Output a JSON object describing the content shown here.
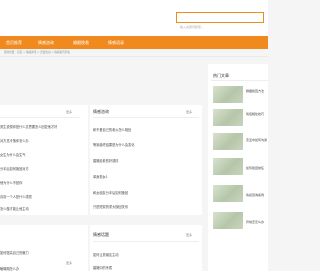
{
  "search": {
    "placeholder": "输入关键词搜索..."
  },
  "nav": [
    "首页推荐",
    "情感咨询",
    "婚姻挽救",
    "情感语录"
  ],
  "breadcrumb": "您的位置：首页 > 情感资讯 > 恋爱知识 > 情感资讯列表",
  "left_cards": [
    {
      "more": "更多",
      "items": [
        "男生说想你是什么意思要怎么回复他才好",
        "对方总冷落你怎么办",
        "女生为什么会生气",
        "分手后如何挽回对方",
        "他为什么不回你",
        "喜欢一个人是什么感觉",
        "怎么做才能让他主动"
      ]
    },
    {
      "more": "更多",
      "items": [
        "如何提高自己的魅力",
        "暧昧期怎么办"
      ]
    }
  ],
  "mid_cards": [
    {
      "title": "情感咨询",
      "more": "更多",
      "items": [
        "和不爱自己的老公怎么相处",
        "等到最终结果是为什么会变化",
        "婚姻走着的好感情",
        "单身男女1",
        "和女朋友分手后如何挽回",
        "只是短暂的重大挽回关系"
      ]
    },
    {
      "title": "情感话题",
      "more": "更多",
      "items": [
        "如何让男朋友主动",
        "婚姻中的矛盾"
      ]
    }
  ],
  "hot": {
    "title": "热门文章",
    "items": [
      "婚姻挽回方法",
      "情侣相处技巧",
      "恋爱中如何沟通",
      "如何挽回前任",
      "情感咨询案例",
      "异地恋怎么办"
    ]
  }
}
